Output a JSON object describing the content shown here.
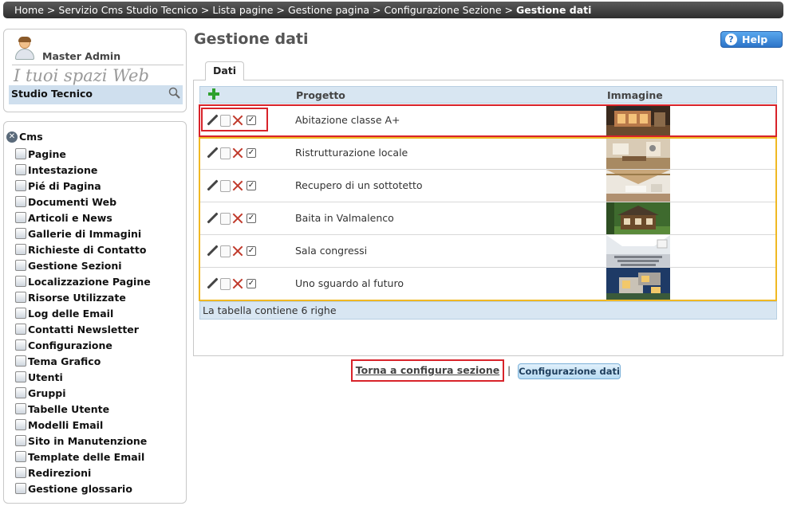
{
  "breadcrumb": [
    {
      "label": "Home"
    },
    {
      "label": "Servizio Cms Studio Tecnico"
    },
    {
      "label": "Lista pagine"
    },
    {
      "label": "Gestione pagina"
    },
    {
      "label": "Configurazione Sezione"
    },
    {
      "label": "Gestione dati"
    }
  ],
  "breadcrumb_separator": ">",
  "user": {
    "name": "Master Admin",
    "spaces_label": "I tuoi spazi Web",
    "site": "Studio Tecnico"
  },
  "menu": {
    "root_label": "Cms",
    "items": [
      {
        "label": "Pagine",
        "icon": "page-icon"
      },
      {
        "label": "Intestazione",
        "icon": "header-icon"
      },
      {
        "label": "Pié di Pagina",
        "icon": "footer-icon"
      },
      {
        "label": "Documenti Web",
        "icon": "web-documents-icon"
      },
      {
        "label": "Articoli e News",
        "icon": "news-icon"
      },
      {
        "label": "Gallerie di Immagini",
        "icon": "gallery-icon"
      },
      {
        "label": "Richieste di Contatto",
        "icon": "contact-requests-icon"
      },
      {
        "label": "Gestione Sezioni",
        "icon": "sections-icon"
      },
      {
        "label": "Localizzazione Pagine",
        "icon": "localization-icon"
      },
      {
        "label": "Risorse Utilizzate",
        "icon": "resources-icon"
      },
      {
        "label": "Log delle Email",
        "icon": "email-log-icon"
      },
      {
        "label": "Contatti Newsletter",
        "icon": "newsletter-icon"
      },
      {
        "label": "Configurazione",
        "icon": "gear-icon"
      },
      {
        "label": "Tema Grafico",
        "icon": "palette-icon"
      },
      {
        "label": "Utenti",
        "icon": "user-icon"
      },
      {
        "label": "Gruppi",
        "icon": "group-icon"
      },
      {
        "label": "Tabelle Utente",
        "icon": "table-icon"
      },
      {
        "label": "Modelli Email",
        "icon": "email-template-icon"
      },
      {
        "label": "Sito in Manutenzione",
        "icon": "maintenance-icon"
      },
      {
        "label": "Template delle Email",
        "icon": "email-icon"
      },
      {
        "label": "Redirezioni",
        "icon": "redirect-icon"
      },
      {
        "label": "Gestione glossario",
        "icon": "glossary-icon"
      }
    ]
  },
  "main": {
    "title": "Gestione dati",
    "help_label": "Help",
    "tab_label": "Dati",
    "table": {
      "columns": [
        "Progetto",
        "Immagine"
      ],
      "rows": [
        {
          "project": "Abitazione classe A+",
          "thumb": "house-modern"
        },
        {
          "project": "Ristrutturazione locale",
          "thumb": "interior-room"
        },
        {
          "project": "Recupero di un sottotetto",
          "thumb": "attic"
        },
        {
          "project": "Baita in Valmalenco",
          "thumb": "mountain-cabin"
        },
        {
          "project": "Sala congressi",
          "thumb": "conference-hall"
        },
        {
          "project": "Uno sguardo al futuro",
          "thumb": "modern-villa"
        }
      ],
      "footer": "La tabella contiene 6 righe"
    },
    "back_link": "Torna a configura sezione",
    "link_separator": "|",
    "config_button": "Configurazione dati"
  },
  "colors": {
    "highlight_red": "#d8232a",
    "highlight_yellow": "#f0b823",
    "header_bg": "#d8e6f2"
  }
}
